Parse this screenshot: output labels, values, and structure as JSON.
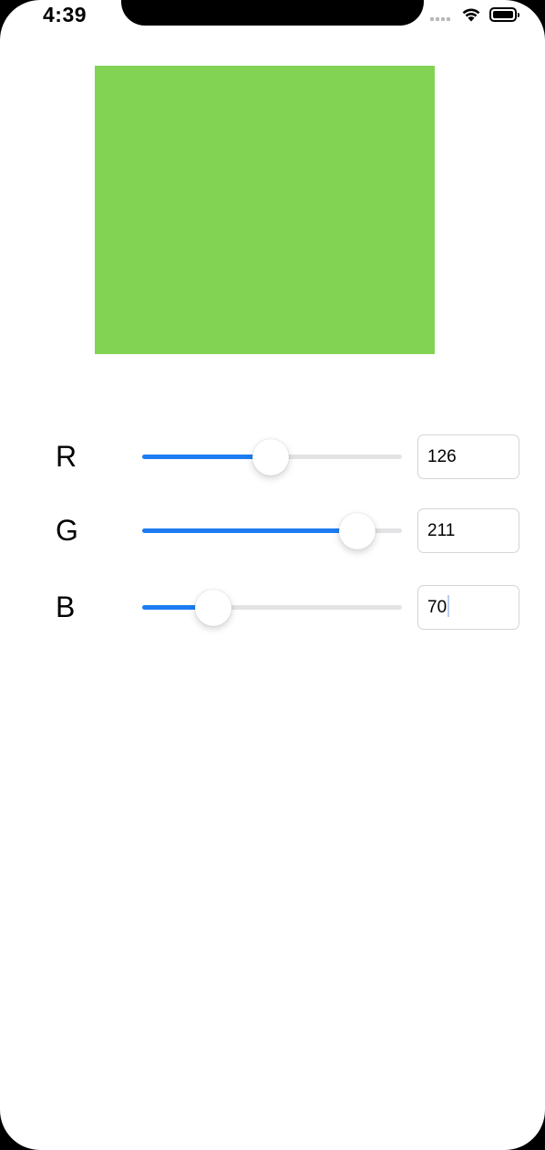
{
  "status_bar": {
    "time": "4:39",
    "icons": [
      "signal-dots-icon",
      "wifi-icon",
      "battery-icon"
    ]
  },
  "preview": {
    "color": "#82d354"
  },
  "accent_color": "#1e7cf2",
  "channels": [
    {
      "label": "R",
      "value": "126",
      "fraction": 0.494
    },
    {
      "label": "G",
      "value": "211",
      "fraction": 0.827
    },
    {
      "label": "B",
      "value": "70",
      "fraction": 0.275,
      "focused": true
    }
  ]
}
